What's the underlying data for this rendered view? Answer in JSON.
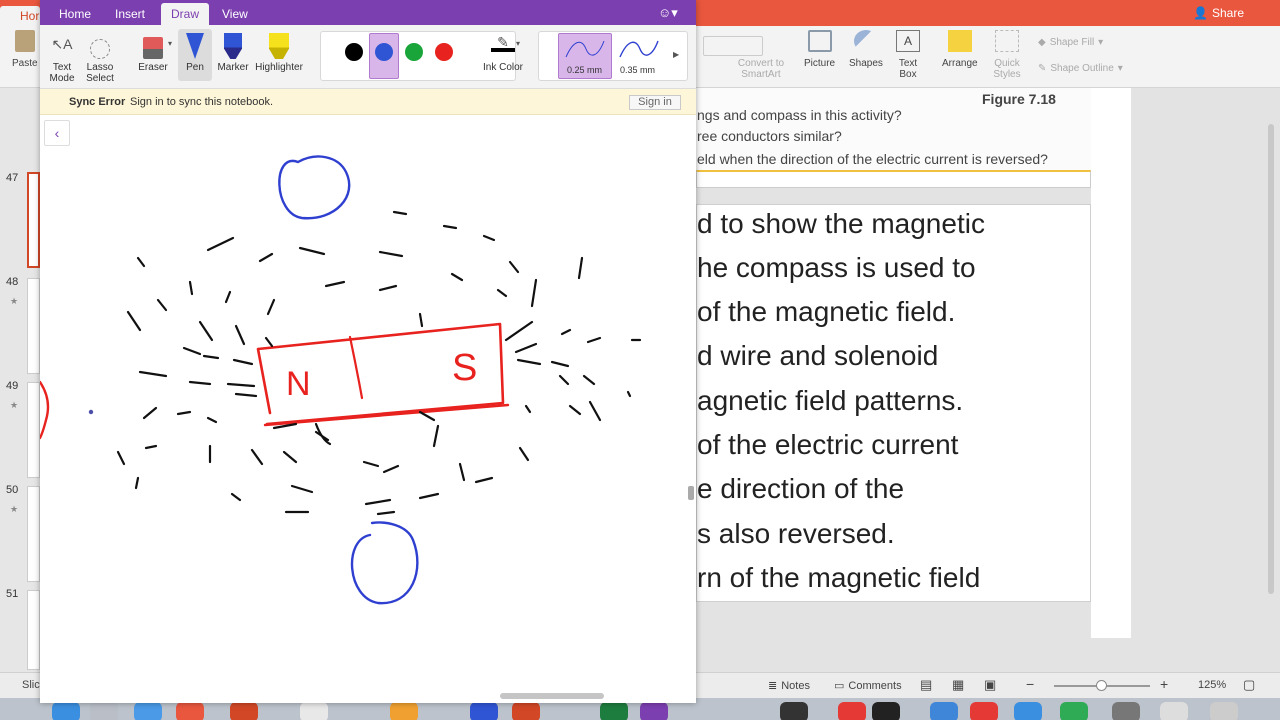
{
  "powerpoint": {
    "share_label": "Share",
    "home_tab_partial": "Hor",
    "paste_partial": "Paste",
    "ribbon": {
      "convert_to_smartart": "Convert to SmartArt",
      "picture": "Picture",
      "shapes": "Shapes",
      "text_box": "Text Box",
      "arrange": "Arrange",
      "quick_styles": "Quick Styles",
      "shape_fill": "Shape Fill",
      "shape_outline": "Shape Outline"
    },
    "thumbnails": [
      {
        "number": "47"
      },
      {
        "number": "48"
      },
      {
        "number": "49"
      },
      {
        "number": "50"
      },
      {
        "number": "51"
      }
    ],
    "figure_caption": "Figure 7.18",
    "question_lines": [
      "ngs and compass in this activity?",
      "ree conductors similar?",
      "eld when the direction of the electric current is reversed?"
    ],
    "slide_lines": [
      "d to show the magnetic",
      "he compass is used to",
      "of the magnetic field.",
      "d wire and solenoid",
      "agnetic field patterns.",
      " of the electric current",
      "e direction of the",
      "s also reversed.",
      "rn of the magnetic field"
    ],
    "status": {
      "slide_partial": "Slic",
      "notes": "Notes",
      "comments": "Comments",
      "zoom": "125%"
    }
  },
  "onenote": {
    "tabs": [
      "Home",
      "Insert",
      "Draw",
      "View"
    ],
    "active_tab": "Draw",
    "tools": {
      "text_mode": "Text\nMode",
      "lasso_select": "Lasso\nSelect",
      "eraser": "Eraser",
      "pen": "Pen",
      "marker": "Marker",
      "highlighter": "Highlighter",
      "ink_color": "Ink Color"
    },
    "pen_colors": [
      "#000000",
      "#2f55d4",
      "#1aa53a",
      "#e8221e"
    ],
    "selected_pen_color": "#2f55d4",
    "thickness_options": [
      "0.25 mm",
      "0.35 mm"
    ],
    "selected_thickness": "0.25 mm",
    "sync": {
      "title": "Sync Error",
      "message": "Sign in to sync this notebook.",
      "button": "Sign in"
    },
    "drawing": {
      "magnet_left_letter": "N",
      "magnet_right_letter": "S",
      "ink_colors": {
        "magnet": "#e8221e",
        "compass": "#2f40d0",
        "field": "#111111"
      }
    }
  },
  "colors": {
    "onenote_brand": "#7c3fb0",
    "powerpoint_brand": "#e9573f"
  }
}
